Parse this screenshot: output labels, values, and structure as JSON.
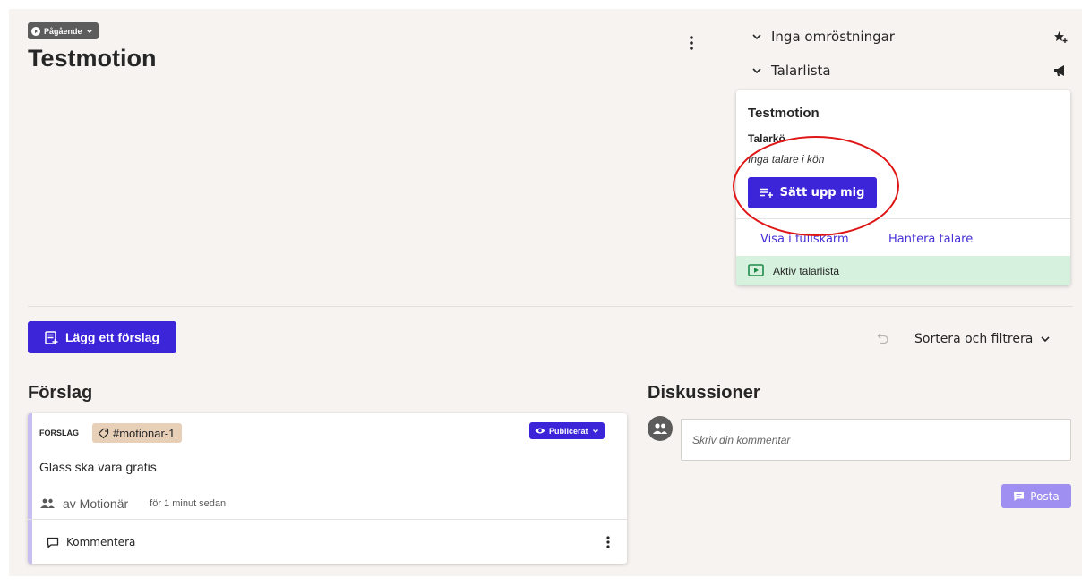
{
  "header": {
    "status": "Pågående",
    "title": "Testmotion"
  },
  "panel": {
    "polls_label": "Inga omröstningar",
    "speakers_label": "Talarlista"
  },
  "speaker_card": {
    "title": "Testmotion",
    "queue_label": "Talarkö",
    "empty_text": "Inga talare i kön",
    "join_button": "Sätt upp mig",
    "fullscreen_link": "Visa i fullskärm",
    "manage_link": "Hantera talare",
    "active_label": "Aktiv talarlista"
  },
  "toolbar": {
    "add_proposal": "Lägg ett förslag",
    "sort_filter": "Sortera och filtrera"
  },
  "proposals": {
    "heading": "Förslag",
    "items": [
      {
        "type": "FÖRSLAG",
        "tag": "#motionar-1",
        "status": "Publicerat",
        "text": "Glass ska vara gratis",
        "author": "av Motionär",
        "time": "för 1 minut sedan",
        "comment_label": "Kommentera"
      }
    ]
  },
  "discussion": {
    "heading": "Diskussioner",
    "placeholder": "Skriv din kommentar",
    "post_button": "Posta"
  },
  "colors": {
    "primary": "#3c24d9",
    "background": "#f6f3f1",
    "active_green": "#d6f2de",
    "tag": "#e8cfb8",
    "annotation_red": "#e01515"
  }
}
